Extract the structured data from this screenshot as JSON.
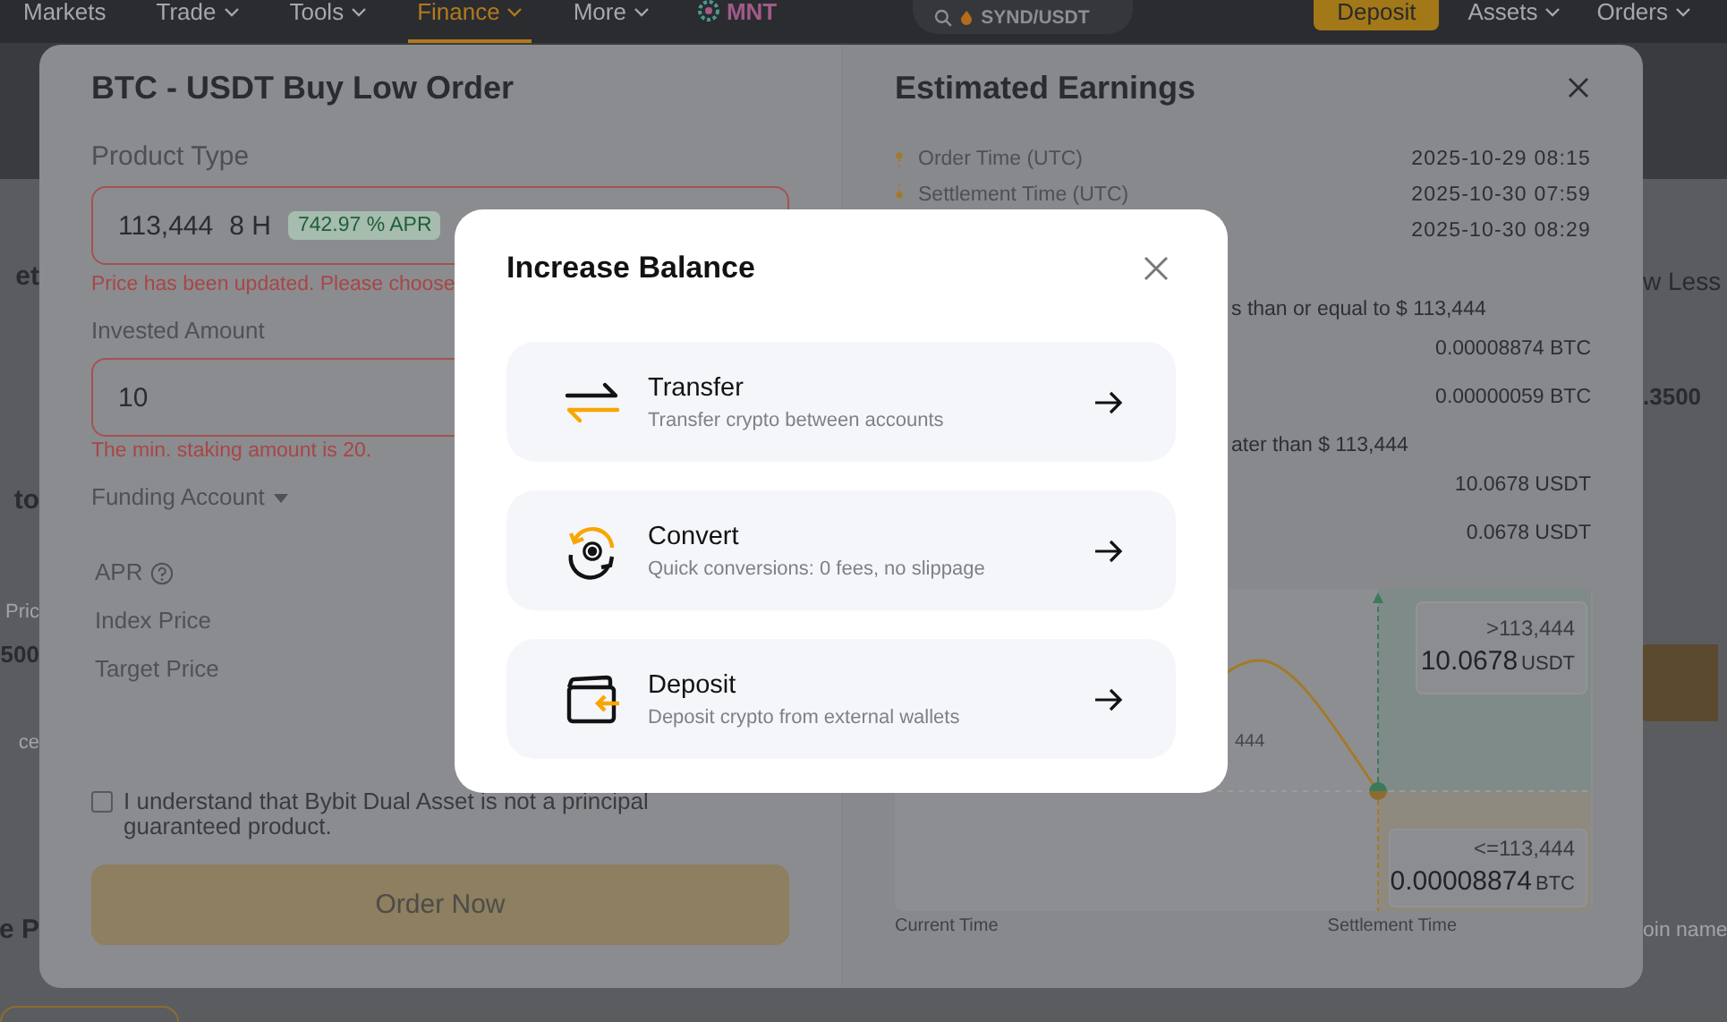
{
  "nav": {
    "items": [
      {
        "label": "Markets",
        "caret": false,
        "selected": false
      },
      {
        "label": "Trade",
        "caret": true,
        "selected": false
      },
      {
        "label": "Tools",
        "caret": true,
        "selected": false
      },
      {
        "label": "Finance",
        "caret": true,
        "selected": true
      },
      {
        "label": "More",
        "caret": true,
        "selected": false
      }
    ],
    "coin": "MNT",
    "search": {
      "value": "SYND/USDT"
    },
    "deposit_button": "Deposit",
    "menus": [
      {
        "label": "Assets"
      },
      {
        "label": "Orders"
      }
    ]
  },
  "backdrop": {
    "left_texts": [
      {
        "text": "et",
        "kind": "heading"
      },
      {
        "text": "to",
        "kind": "heading"
      },
      {
        "text": "Pric",
        "kind": "label"
      },
      {
        "text": "500",
        "kind": "value"
      },
      {
        "text": "ce",
        "kind": "label"
      },
      {
        "text": "e P",
        "kind": "heading"
      }
    ],
    "right_texts": [
      {
        "text": "w Less",
        "kind": "link"
      },
      {
        "text": ".3500",
        "kind": "value"
      },
      {
        "text": "oin name",
        "kind": "label"
      }
    ]
  },
  "order": {
    "title": "BTC - USDT Buy Low Order",
    "product_label": "Product Type",
    "product": {
      "price": "113,444",
      "term": "8 H",
      "apr": "742.97 % APR"
    },
    "product_error": "Price has been updated. Please choose",
    "amount_label": "Invested Amount",
    "amount": {
      "value": "10"
    },
    "amount_error": "The min. staking amount is 20.",
    "funding_label": "Funding Account",
    "details": [
      {
        "label": "APR",
        "help": true
      },
      {
        "label": "Index Price",
        "help": false
      },
      {
        "label": "Target Price",
        "help": false
      }
    ],
    "agreement": {
      "text": "I understand that Bybit Dual Asset is not a principal guaranteed product.",
      "checked": false
    },
    "order_button": {
      "label": "Order Now",
      "disabled": true
    }
  },
  "earnings": {
    "title": "Estimated Earnings",
    "times": [
      {
        "label": "Order Time (UTC)",
        "value": "2025-10-29 08:15"
      },
      {
        "label": "Settlement Time (UTC)",
        "value": "2025-10-30 07:59"
      },
      {
        "value": "2025-10-30 08:29"
      }
    ],
    "outcomes": [
      {
        "condition": "s than or equal to $ 113,444",
        "values": [
          "0.00008874 BTC",
          "0.00000059 BTC"
        ]
      },
      {
        "condition": "ater than $ 113,444",
        "values": [
          "10.0678 USDT",
          "0.0678 USDT"
        ]
      }
    ],
    "chart": {
      "upper": {
        "condition": ">113,444",
        "amount": "10.0678",
        "unit": "USDT"
      },
      "lower": {
        "condition": "<=113,444",
        "amount": "0.00008874",
        "unit": "BTC"
      },
      "price_fragment": "444",
      "x_labels": [
        "Current Time",
        "Settlement Time"
      ]
    }
  },
  "dialog": {
    "title": "Increase Balance",
    "options": [
      {
        "kind": "transfer",
        "title": "Transfer",
        "subtitle": "Transfer crypto between accounts"
      },
      {
        "kind": "convert",
        "title": "Convert",
        "subtitle": "Quick conversions: 0 fees, no slippage"
      },
      {
        "kind": "deposit",
        "title": "Deposit",
        "subtitle": "Deposit crypto from external wallets"
      }
    ]
  }
}
